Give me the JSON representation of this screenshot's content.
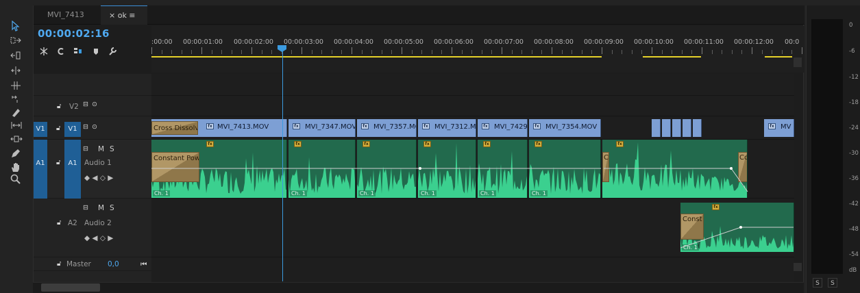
{
  "tabs": [
    {
      "label": "MVI_7413",
      "active": false
    },
    {
      "label": "× ok ≡",
      "active": true
    }
  ],
  "timecode": "00:00:02:16",
  "ruler_labels": [
    ":00:00",
    "00:00:01:00",
    "00:00:02:00",
    "00:00:03:00",
    "00:00:04:00",
    "00:00:05:00",
    "00:00:06:00",
    "00:00:07:00",
    "00:00:08:00",
    "00:00:09:00",
    "00:00:10:00",
    "00:00:11:00",
    "00:00:12:00",
    "00:0"
  ],
  "tracks": {
    "v2": {
      "target": "V2"
    },
    "v1": {
      "source": "V1",
      "target": "V1"
    },
    "a1": {
      "source": "A1",
      "target": "A1",
      "name": "Audio 1",
      "mute": "M",
      "solo": "S"
    },
    "a2": {
      "target": "A2",
      "name": "Audio 2",
      "mute": "M",
      "solo": "S"
    },
    "master": {
      "name": "Master",
      "value": "0,0"
    }
  },
  "video_clips": [
    {
      "name": "Cross Dissolv"
    },
    {
      "name": "MVI_7413.MOV"
    },
    {
      "name": "MVI_7347.MOV"
    },
    {
      "name": "MVI_7357.MC"
    },
    {
      "name": "MVI_7312.M"
    },
    {
      "name": "MVI_7429"
    },
    {
      "name": "MVI_7354.MOV"
    },
    {
      "name": "MV"
    }
  ],
  "audio_transition_a1": "Constant Pow",
  "audio_transition_a2": "Const",
  "audio_transition_right": "Co",
  "audio_transition_c": "C",
  "channel_tag": "Ch. 1",
  "meter_labels": [
    "0",
    "-6",
    "-12",
    "-18",
    "-24",
    "-30",
    "-36",
    "-42",
    "-48",
    "-54",
    "dB"
  ],
  "meter_buttons": [
    "S",
    "S"
  ],
  "colors": {
    "video_clip": "#7d9fd4",
    "audio_clip": "#226a4d",
    "waveform": "#3bd08f",
    "playhead": "#3b9be0",
    "work_area": "#e6d22a"
  },
  "icons": [
    "selection-tool-icon",
    "track-select-icon",
    "ripple-edit-icon",
    "rolling-edit-icon",
    "rate-stretch-icon",
    "razor-icon",
    "slip-icon",
    "slide-icon",
    "pen-icon",
    "hand-icon",
    "zoom-icon",
    "snap-icon",
    "linked-selection-icon",
    "add-marker-icon",
    "wrench-icon"
  ]
}
